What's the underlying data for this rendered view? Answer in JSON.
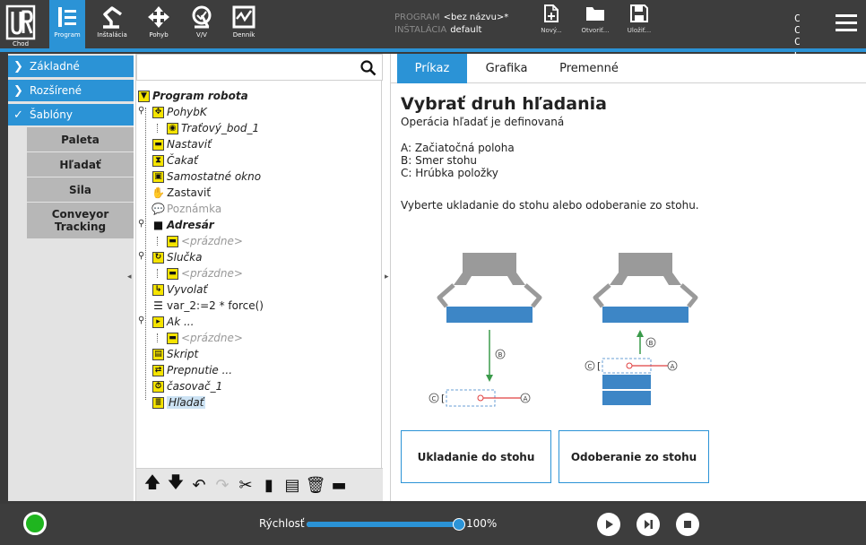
{
  "topbar": {
    "logo_label": "Chod",
    "nav": [
      {
        "label": "Program",
        "icon": "program-icon",
        "active": true
      },
      {
        "label": "Inštalácia",
        "icon": "robot-arm-icon",
        "active": false
      },
      {
        "label": "Pohyb",
        "icon": "move-arrows-icon",
        "active": false
      },
      {
        "label": "V/V",
        "icon": "io-icon",
        "active": false
      },
      {
        "label": "Denník",
        "icon": "log-icon",
        "active": false
      }
    ],
    "program_key": "PROGRAM",
    "program_value": "<bez názvu>*",
    "installation_key": "INŠTALÁCIA",
    "installation_value": "default",
    "file_buttons": [
      {
        "label": "Nový...",
        "icon": "new-file-icon"
      },
      {
        "label": "Otvoriť...",
        "icon": "folder-icon"
      },
      {
        "label": "Uložiť...",
        "icon": "save-icon"
      }
    ],
    "cc": [
      "C C",
      "C C"
    ]
  },
  "leftnav": {
    "categories": [
      {
        "label": "Základné",
        "expanded": false
      },
      {
        "label": "Rozšírené",
        "expanded": false
      },
      {
        "label": "Šablóny",
        "expanded": true
      }
    ],
    "templates": [
      "Paleta",
      "Hľadať",
      "Sila",
      "Conveyor Tracking"
    ]
  },
  "tree": {
    "search_placeholder": "",
    "nodes": [
      {
        "label": "Program robota"
      },
      {
        "label": "PohybK"
      },
      {
        "label": "Traťový_bod_1"
      },
      {
        "label": "Nastaviť"
      },
      {
        "label": "Čakať"
      },
      {
        "label": "Samostatné okno"
      },
      {
        "label": "Zastaviť"
      },
      {
        "label": "Poznámka"
      },
      {
        "label": "Adresár"
      },
      {
        "label": "<prázdne>"
      },
      {
        "label": "Slučka"
      },
      {
        "label": "<prázdne>"
      },
      {
        "label": "Vyvolať"
      },
      {
        "label": "var_2:=2 * force()"
      },
      {
        "label": "Ak ..."
      },
      {
        "label": "<prázdne>"
      },
      {
        "label": "Skript"
      },
      {
        "label": "Prepnutie ..."
      },
      {
        "label": "časovač_1"
      },
      {
        "label": "Hľadať"
      }
    ],
    "toolbar": [
      "move-up-icon",
      "move-down-icon",
      "undo-icon",
      "redo-icon",
      "cut-icon",
      "copy-icon",
      "paste-icon",
      "delete-icon",
      "suppress-icon"
    ]
  },
  "right": {
    "tabs": [
      "Príkaz",
      "Grafika",
      "Premenné"
    ],
    "title": "Vybrať druh hľadania",
    "subtitle": "Operácia hľadať je definovaná",
    "legend": [
      "A: Začiatočná poloha",
      "B: Smer stohu",
      "C: Hrúbka položky"
    ],
    "instruction": "Vyberte ukladanie do stohu alebo odoberanie zo stohu.",
    "diagram_labels": {
      "a": "A",
      "b": "B",
      "c": "C"
    },
    "buttons": [
      "Ukladanie do stohu",
      "Odoberanie zo stohu"
    ]
  },
  "bottombar": {
    "speed_label": "Rýchlosť",
    "speed_value": "100%",
    "speed_fraction": 1.0,
    "controls": [
      "play-icon",
      "step-icon",
      "stop-icon"
    ],
    "status_color": "#1fb51f"
  },
  "colors": {
    "accent": "#2b93d6",
    "node_icon": "#f5e400",
    "topbar": "#3d3d3d"
  }
}
